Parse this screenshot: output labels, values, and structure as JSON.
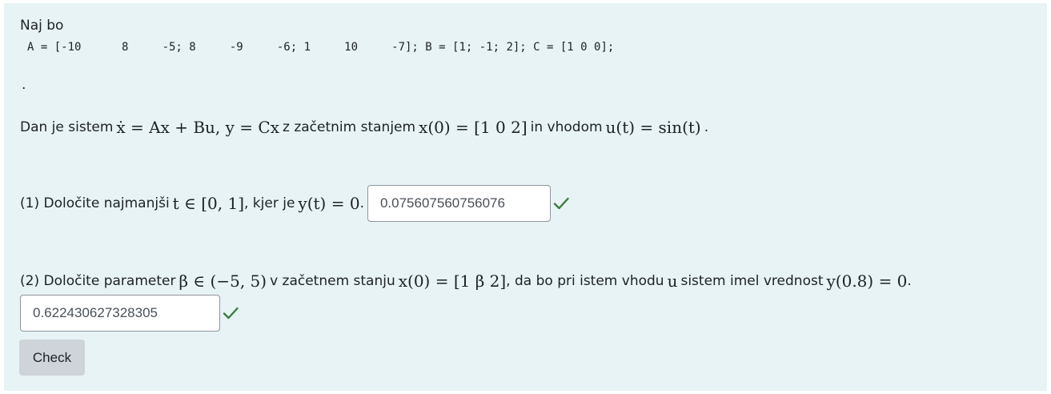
{
  "intro": {
    "text": "Naj bo",
    "code": "A = [-10      8     -5; 8     -9     -6; 1     10     -7]; B = [1; -1; 2]; C = [1 0 0];",
    "dot": "."
  },
  "system": {
    "prefix": "Dan je sistem",
    "eq": "ẋ = Ax + Bu, y = Cx",
    "mid1": "z začetnim stanjem",
    "initial": "x(0) = [1  0  2]",
    "mid2": "in vhodom",
    "input": "u(t) = sin(t)",
    "end": "."
  },
  "q1": {
    "prefix": "(1) Določite najmanjši",
    "interval": "t ∈ [0, 1]",
    "mid": ", kjer je",
    "condition": "y(t) = 0",
    "end": ".",
    "answer": "0.075607560756076",
    "status_icon": "check-icon",
    "status_color": "#3a7d3e"
  },
  "q2": {
    "prefix": "(2) Določite parameter",
    "range": "β ∈ (−5, 5)",
    "mid1": "v začetnem stanju",
    "initial": "x(0) = [1  β  2]",
    "mid2": ", da bo pri istem vhodu",
    "u": "u",
    "mid3": "sistem imel vrednost",
    "condition": "y(0.8) = 0",
    "end": ".",
    "answer": "0.622430627328305",
    "status_icon": "check-icon",
    "status_color": "#3a7d3e"
  },
  "actions": {
    "check_label": "Check"
  }
}
